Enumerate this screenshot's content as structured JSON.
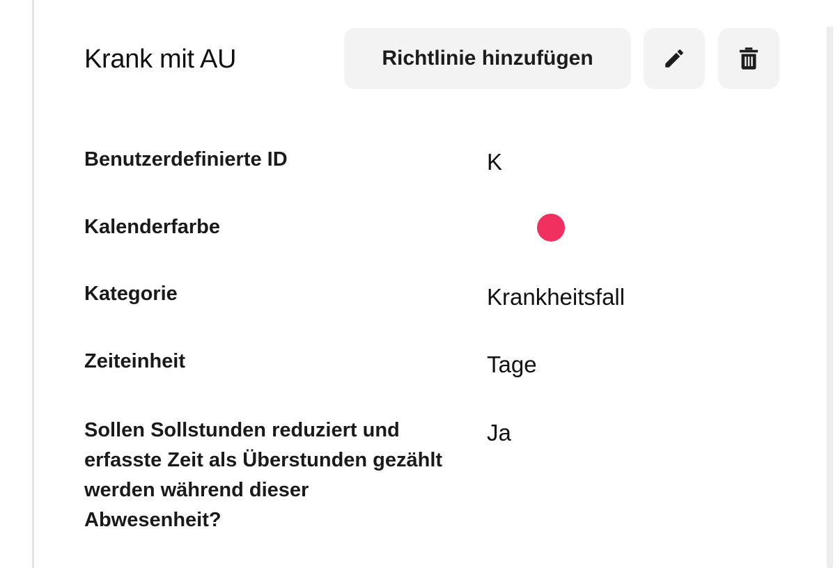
{
  "header": {
    "title": "Krank mit AU",
    "add_policy_label": "Richtlinie hinzufügen",
    "edit_icon": "pencil-icon",
    "delete_icon": "trash-icon"
  },
  "details": [
    {
      "label": "Benutzerdefinierte ID",
      "value": "K"
    },
    {
      "label": "Kalenderfarbe",
      "value_color": "#f0305f"
    },
    {
      "label": "Kategorie",
      "value": "Krankheitsfall"
    },
    {
      "label": "Zeiteinheit",
      "value": "Tage"
    },
    {
      "label": "Sollen Sollstunden reduziert und erfasste Zeit als Überstunden gezählt werden während dieser Abwesenheit?",
      "value": "Ja"
    }
  ]
}
